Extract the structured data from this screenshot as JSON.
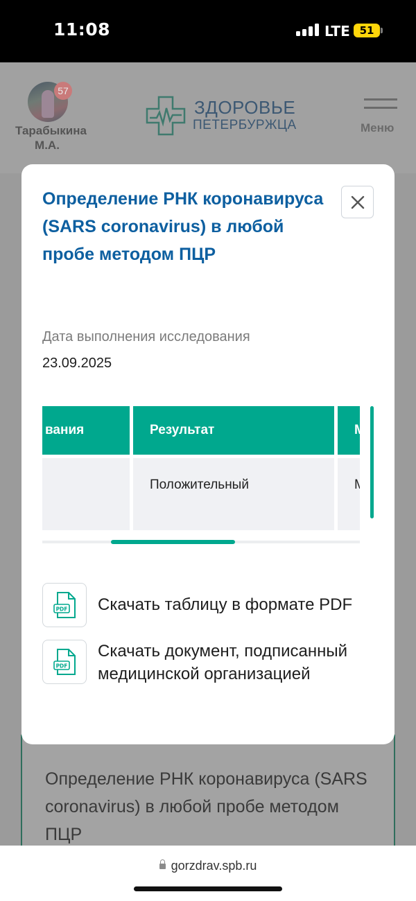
{
  "status_bar": {
    "time": "11:08",
    "network": "LTE",
    "battery": "51"
  },
  "header": {
    "user_name": "Тарабыкина М.А.",
    "notification_count": "57",
    "logo_title": "ЗДОРОВЬЕ",
    "logo_subtitle": "ПЕТЕРБУРЖЦА",
    "menu_label": "Меню"
  },
  "modal": {
    "title": "Определение РНК коронавируса (SARS coronavirus) в любой пробе методом ПЦР",
    "date_label": "Дата выполнения исследования",
    "date_value": "23.09.2025",
    "table": {
      "headers": [
        "вания",
        "Результат",
        "Ми"
      ],
      "rows": [
        [
          "",
          "Положительный",
          "Мак"
        ]
      ]
    },
    "downloads": [
      {
        "icon": "pdf-file-icon",
        "label": "Скачать таблицу в формате PDF"
      },
      {
        "icon": "pdf-file-icon",
        "label": "Скачать документ, подписанный медицинской организацией"
      }
    ]
  },
  "background_card": {
    "text": "Определение РНК коронавируса (SARS coronavirus) в любой пробе методом ПЦР"
  },
  "browser": {
    "url": "gorzdrav.spb.ru"
  },
  "colors": {
    "accent": "#00a88e",
    "title_blue": "#0d5fa0",
    "overlay": "#9b9b9b"
  }
}
